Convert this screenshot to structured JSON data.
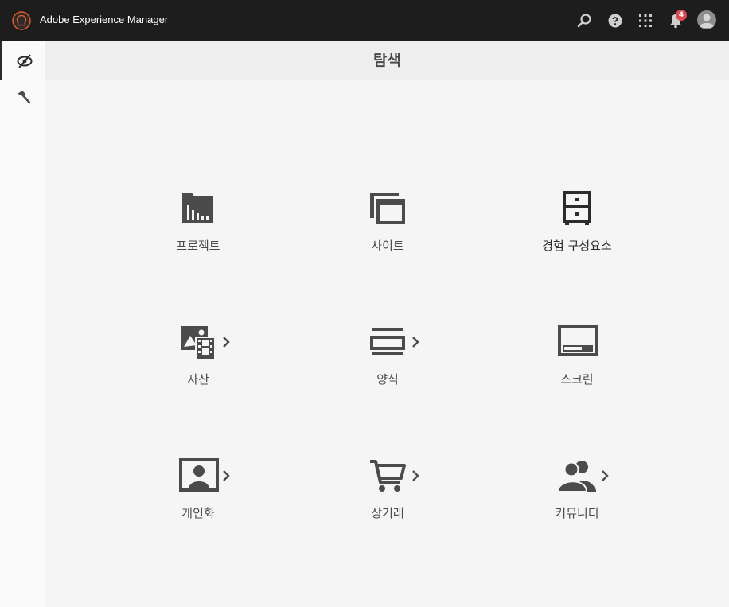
{
  "topbar": {
    "app_title": "Adobe Experience Manager",
    "notification_count": "4",
    "icons": [
      "search-icon",
      "help-icon",
      "apps-grid-icon",
      "bell-icon",
      "user-avatar"
    ]
  },
  "rail": {
    "items": [
      {
        "icon": "navigation-icon",
        "active": true
      },
      {
        "icon": "tools-hammer-icon",
        "active": false
      }
    ]
  },
  "main": {
    "title": "탐색",
    "tiles": [
      {
        "label": "프로젝트",
        "icon": "projects-folder-icon"
      },
      {
        "label": "사이트",
        "icon": "sites-icon"
      },
      {
        "label": "경험 구성요소",
        "icon": "experience-fragments-icon"
      },
      {
        "label": "자산",
        "icon": "assets-icon",
        "has_submenu": true
      },
      {
        "label": "양식",
        "icon": "forms-icon",
        "has_submenu": true
      },
      {
        "label": "스크린",
        "icon": "screens-icon"
      },
      {
        "label": "개인화",
        "icon": "personalization-icon",
        "has_submenu": true
      },
      {
        "label": "상거래",
        "icon": "commerce-cart-icon",
        "has_submenu": true
      },
      {
        "label": "커뮤니티",
        "icon": "communities-icon",
        "has_submenu": true
      }
    ]
  },
  "colors": {
    "topbar_bg": "#1d1d1d",
    "icon_gray": "#4b4b4b",
    "badge_red": "#e34850",
    "brand_orange": "#e65a28"
  }
}
